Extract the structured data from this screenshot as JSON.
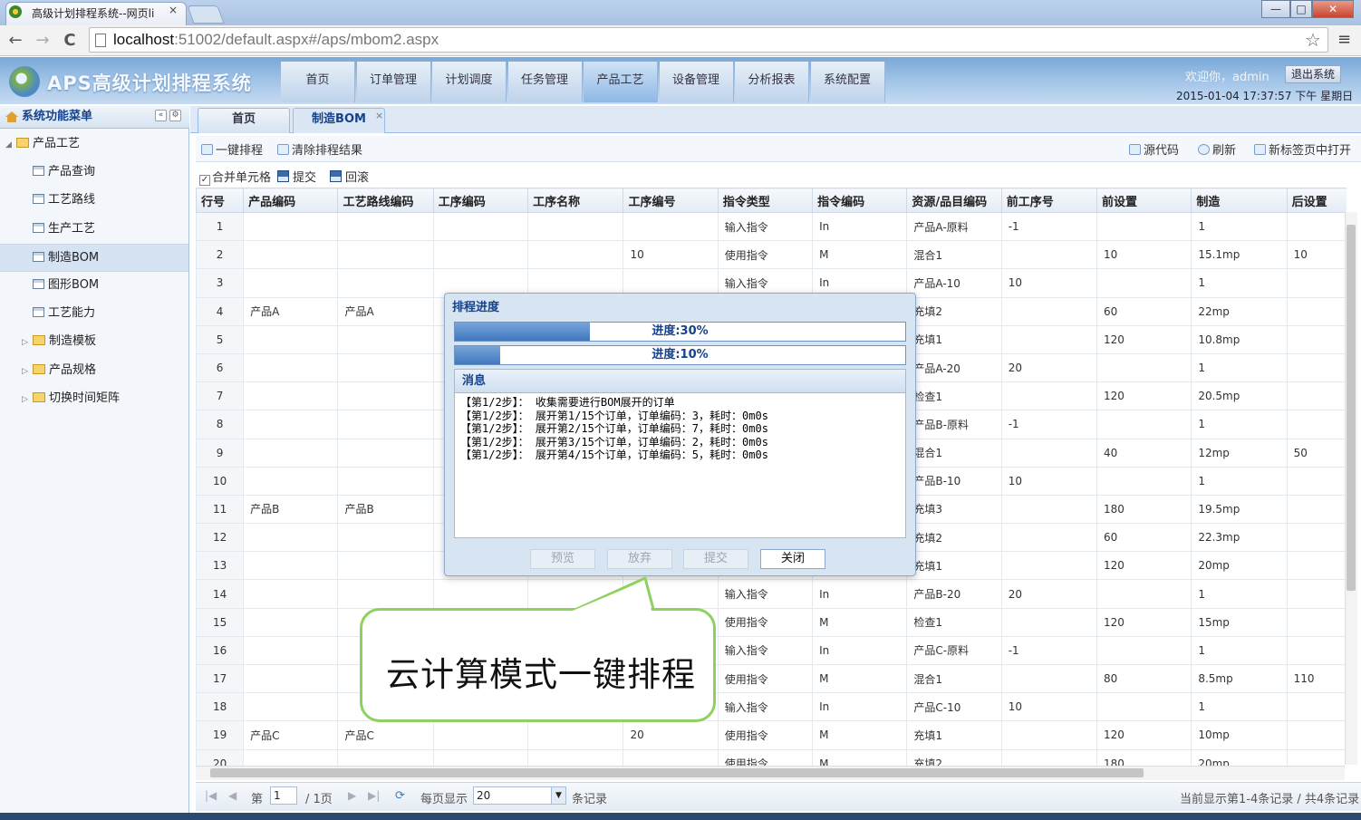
{
  "browser": {
    "tab_title": "高级计划排程系统--网页li",
    "tab_close": "×",
    "url_host": "localhost",
    "url_rest": ":51002/default.aspx#/aps/mbom2.aspx",
    "back": "←",
    "forward": "→",
    "reload": "C",
    "star": "☆",
    "menu": "≡",
    "win_min": "—",
    "win_max": "□",
    "win_close": "✕"
  },
  "app": {
    "logo": "APS高级计划排程系统",
    "nav": [
      "首页",
      "订单管理",
      "计划调度",
      "任务管理",
      "产品工艺",
      "设备管理",
      "分析报表",
      "系统配置"
    ],
    "active_nav": "产品工艺",
    "welcome": "欢迎你，admin",
    "logout": "退出系统",
    "datetime": "2015-01-04 17:37:57 下午 星期日"
  },
  "sidebar": {
    "title": "系统功能菜单",
    "collapse": "«",
    "gear": "⚙",
    "items": [
      {
        "label": "产品工艺",
        "type": "folder-open"
      },
      {
        "label": "产品查询",
        "type": "page"
      },
      {
        "label": "工艺路线",
        "type": "page"
      },
      {
        "label": "生产工艺",
        "type": "page"
      },
      {
        "label": "制造BOM",
        "type": "page",
        "selected": true
      },
      {
        "label": "图形BOM",
        "type": "page"
      },
      {
        "label": "工艺能力",
        "type": "page"
      },
      {
        "label": "制造模板",
        "type": "folder"
      },
      {
        "label": "产品规格",
        "type": "folder"
      },
      {
        "label": "切换时间矩阵",
        "type": "folder"
      }
    ]
  },
  "tabs": {
    "home": "首页",
    "current": "制造BOM",
    "close": "×"
  },
  "actions": {
    "schedule": "一键排程",
    "clear": "清除排程结果",
    "source": "源代码",
    "refresh": "刷新",
    "newtab": "新标签页中打开",
    "merge_cells": "合并单元格",
    "merge_checked": "✓",
    "submit": "提交",
    "rollback": "回滚"
  },
  "grid": {
    "headers": [
      "行号",
      "产品编码",
      "工艺路线编码",
      "工序编码",
      "工序名称",
      "工序编号",
      "指令类型",
      "指令编码",
      "资源/品目编码",
      "前工序号",
      "前设置",
      "制造",
      "后设置"
    ],
    "rows": [
      [
        "1",
        "",
        "",
        "",
        "",
        "",
        "输入指令",
        "In",
        "产品A-原料",
        "-1",
        "",
        "1",
        ""
      ],
      [
        "2",
        "",
        "",
        "",
        "",
        "10",
        "使用指令",
        "M",
        "混合1",
        "",
        "10",
        "15.1mp",
        "10"
      ],
      [
        "3",
        "",
        "",
        "",
        "",
        "",
        "输入指令",
        "In",
        "产品A-10",
        "10",
        "",
        "1",
        ""
      ],
      [
        "4",
        "产品A",
        "产品A",
        "",
        "",
        "",
        "",
        "",
        "充填2",
        "",
        "60",
        "22mp",
        ""
      ],
      [
        "5",
        "",
        "",
        "",
        "",
        "",
        "",
        "",
        "充填1",
        "",
        "120",
        "10.8mp",
        ""
      ],
      [
        "6",
        "",
        "",
        "",
        "",
        "",
        "",
        "",
        "产品A-20",
        "20",
        "",
        "1",
        ""
      ],
      [
        "7",
        "",
        "",
        "",
        "",
        "",
        "",
        "",
        "检查1",
        "",
        "120",
        "20.5mp",
        ""
      ],
      [
        "8",
        "",
        "",
        "",
        "",
        "",
        "",
        "",
        "产品B-原料",
        "-1",
        "",
        "1",
        ""
      ],
      [
        "9",
        "",
        "",
        "",
        "",
        "",
        "",
        "",
        "混合1",
        "",
        "40",
        "12mp",
        "50"
      ],
      [
        "10",
        "",
        "",
        "",
        "",
        "",
        "",
        "",
        "产品B-10",
        "10",
        "",
        "1",
        ""
      ],
      [
        "11",
        "产品B",
        "产品B",
        "",
        "",
        "",
        "",
        "",
        "充填3",
        "",
        "180",
        "19.5mp",
        ""
      ],
      [
        "12",
        "",
        "",
        "",
        "",
        "",
        "",
        "",
        "充填2",
        "",
        "60",
        "22.3mp",
        ""
      ],
      [
        "13",
        "",
        "",
        "",
        "",
        "",
        "",
        "",
        "充填1",
        "",
        "120",
        "20mp",
        ""
      ],
      [
        "14",
        "",
        "",
        "",
        "",
        "",
        "输入指令",
        "In",
        "产品B-20",
        "20",
        "",
        "1",
        ""
      ],
      [
        "15",
        "",
        "",
        "",
        "",
        "",
        "使用指令",
        "M",
        "检查1",
        "",
        "120",
        "15mp",
        ""
      ],
      [
        "16",
        "",
        "",
        "",
        "",
        "",
        "输入指令",
        "In",
        "产品C-原料",
        "-1",
        "",
        "1",
        ""
      ],
      [
        "17",
        "",
        "",
        "",
        "",
        "",
        "使用指令",
        "M",
        "混合1",
        "",
        "80",
        "8.5mp",
        "110"
      ],
      [
        "18",
        "",
        "",
        "",
        "",
        "",
        "输入指令",
        "In",
        "产品C-10",
        "10",
        "",
        "1",
        ""
      ],
      [
        "19",
        "产品C",
        "产品C",
        "",
        "",
        "20",
        "使用指令",
        "M",
        "充填1",
        "",
        "120",
        "10mp",
        ""
      ],
      [
        "20",
        "",
        "",
        "",
        "",
        "",
        "使用指令",
        "M",
        "充填2",
        "",
        "180",
        "20mp",
        ""
      ]
    ]
  },
  "pager": {
    "page_prefix": "第",
    "page_value": "1",
    "page_suffix": "/ 1页",
    "per_page_label": "每页显示",
    "per_page_value": "20",
    "records_label": "条记录",
    "summary": "当前显示第1-4条记录 / 共4条记录"
  },
  "modal": {
    "title": "排程进度",
    "progress1": {
      "label": "进度:30%",
      "value": 0.3
    },
    "progress2": {
      "label": "进度:10%",
      "value": 0.1
    },
    "msg_title": "消息",
    "messages": [
      "【第1/2步】： 收集需要进行BOM展开的订单",
      "【第1/2步】： 展开第1/15个订单，订单编码：3，耗时：0m0s",
      "【第1/2步】： 展开第2/15个订单，订单编码：7，耗时：0m0s",
      "【第1/2步】： 展开第3/15个订单，订单编码：2，耗时：0m0s",
      "【第1/2步】： 展开第4/15个订单，订单编码：5，耗时：0m0s"
    ],
    "buttons": {
      "preview": "预览",
      "discard": "放弃",
      "submit": "提交",
      "close": "关闭"
    }
  },
  "callout": {
    "text": "云计算模式一键排程"
  },
  "colors": {
    "accent": "#15428b",
    "callout_border": "#8fd160",
    "header_blue": "#7aa8d8"
  }
}
